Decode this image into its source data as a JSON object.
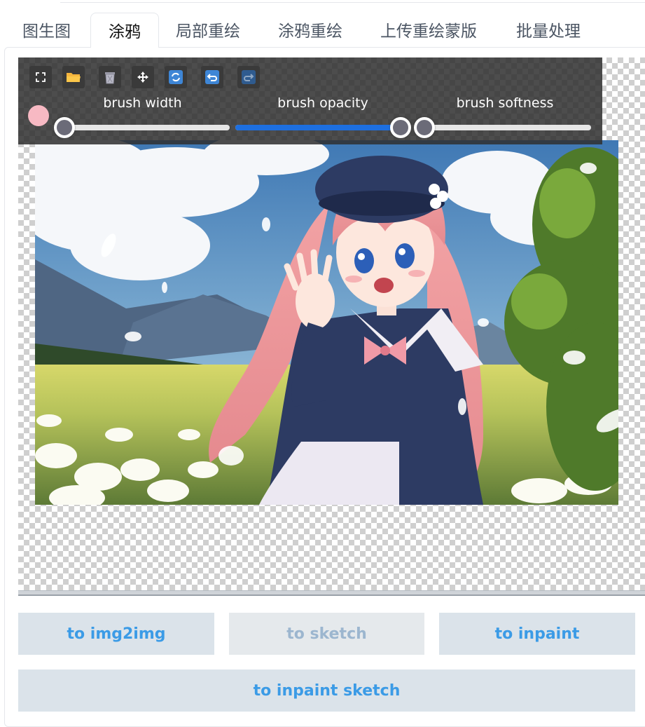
{
  "tabs": [
    {
      "label": "图生图"
    },
    {
      "label": "涂鸦",
      "active": true
    },
    {
      "label": "局部重绘"
    },
    {
      "label": "涂鸦重绘"
    },
    {
      "label": "上传重绘蒙版"
    },
    {
      "label": "批量处理"
    }
  ],
  "toolbar": {
    "icons": [
      "fullscreen-icon",
      "folder-icon",
      "trash-icon",
      "move-icon",
      "reset-icon",
      "undo-icon",
      "redo-icon"
    ],
    "brush_color": "#f7b9c3",
    "sliders": {
      "width_label": "brush width",
      "opacity_label": "brush opacity",
      "softness_label": "brush softness",
      "width_value": 0.0,
      "opacity_value": 1.0,
      "softness_value": 0.0
    }
  },
  "buttons": {
    "img2img": "to img2img",
    "sketch": "to sketch",
    "inpaint": "to inpaint",
    "inpaint_sketch": "to inpaint sketch"
  },
  "colors": {
    "accent": "#3b9be6",
    "slider_fill": "#1d6fe0",
    "button_bg": "#dbe3ea"
  }
}
